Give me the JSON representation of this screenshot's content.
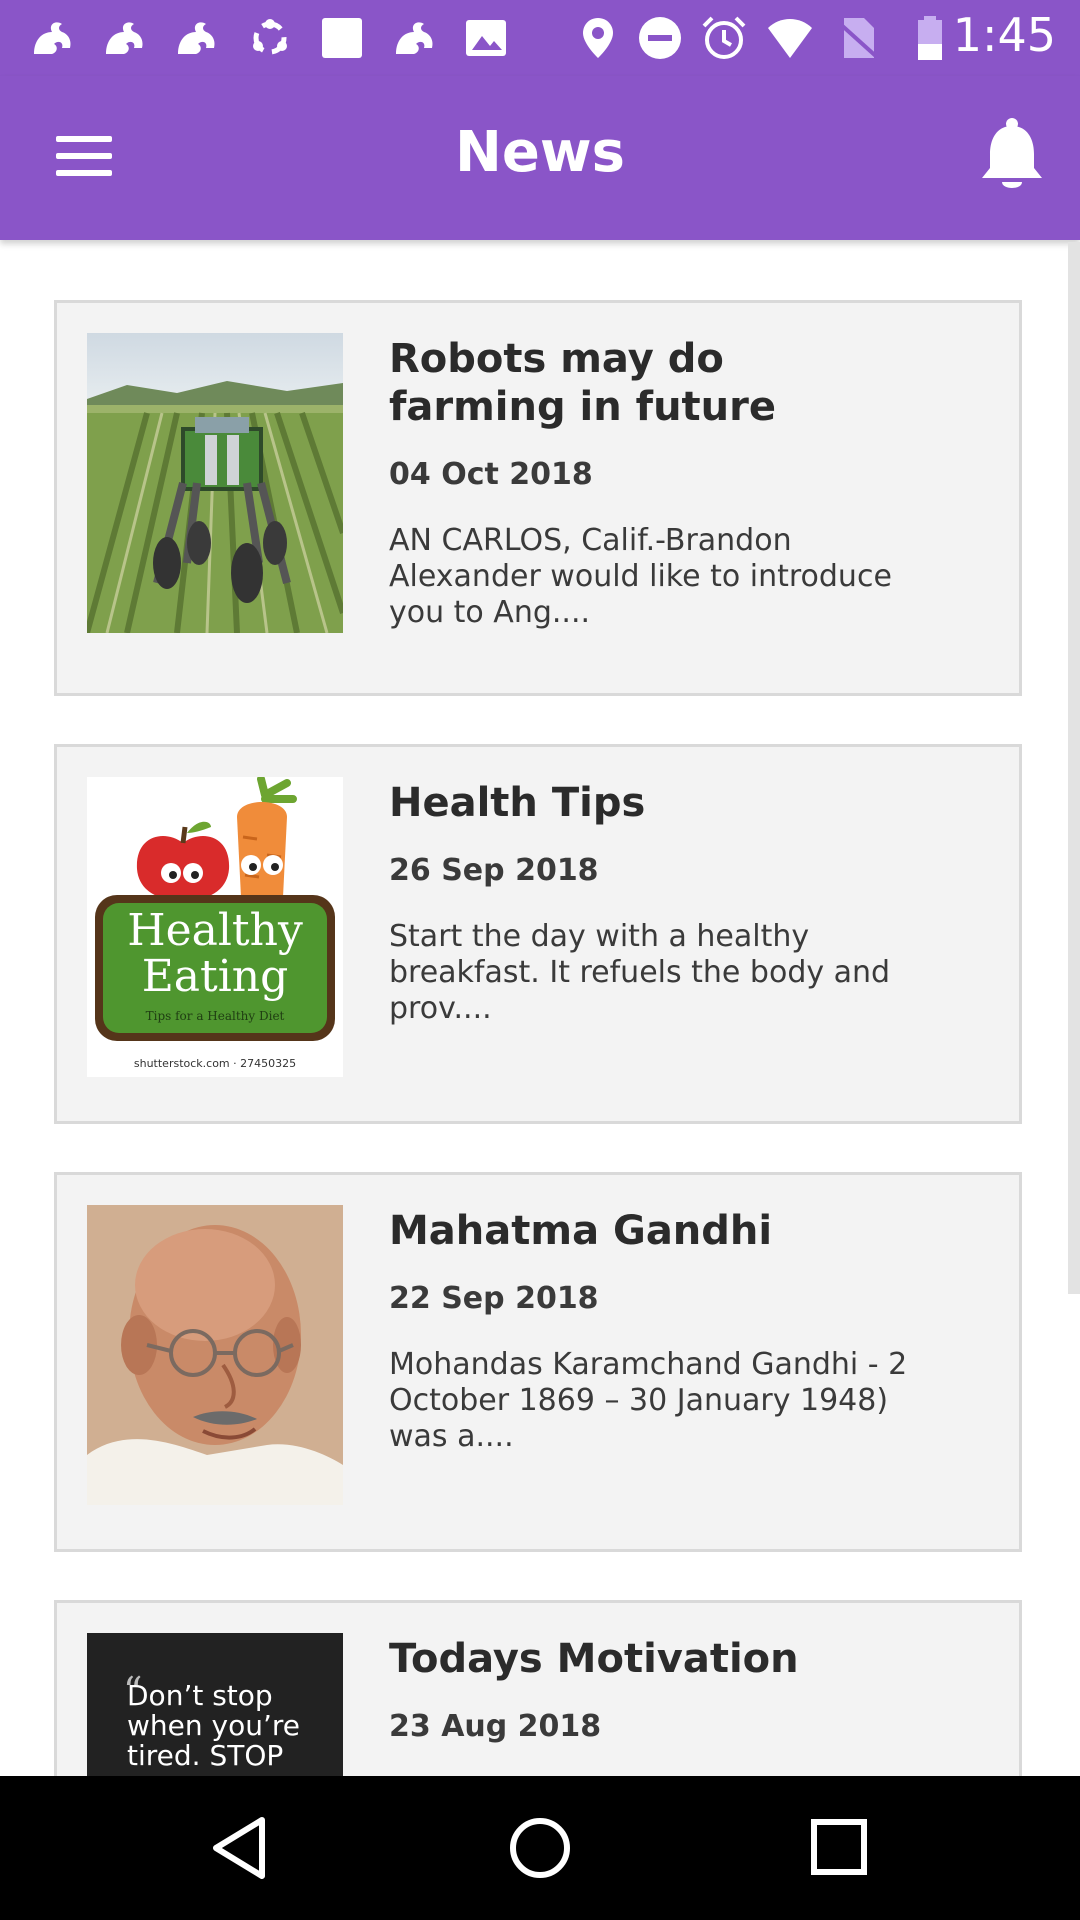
{
  "status_bar": {
    "time": "1:45",
    "icons": [
      "uc-browser-icon",
      "uc-browser-icon",
      "uc-browser-icon",
      "sync-icon",
      "square-icon",
      "uc-browser-icon",
      "image-icon",
      "location-icon",
      "do-not-disturb-icon",
      "alarm-icon",
      "wifi-icon",
      "no-sim-icon",
      "battery-icon"
    ]
  },
  "app_bar": {
    "title": "News",
    "menu_icon": "hamburger-menu-icon",
    "notification_icon": "bell-icon"
  },
  "articles": [
    {
      "title": "Robots may do farming in future",
      "date": "04 Oct 2018",
      "excerpt": "AN CARLOS, Calif.-Brandon Alexander would like to introduce you to Ang....",
      "thumbnail": "farm-robot-photo"
    },
    {
      "title": "Health Tips",
      "date": "26 Sep 2018",
      "excerpt": "Start the day with a healthy breakfast. It refuels the body and prov....",
      "thumbnail": "healthy-eating-illustration",
      "thumb_text": {
        "line1": "Healthy",
        "line2": "Eating",
        "subtitle": "Tips for a Healthy Diet",
        "credit": "shutterstock.com · 27450325"
      }
    },
    {
      "title": "Mahatma Gandhi",
      "date": "22 Sep 2018",
      "excerpt": "Mohandas Karamchand Gandhi - 2 October 1869 – 30 January 1948) was a....",
      "thumbnail": "gandhi-portrait"
    },
    {
      "title": "Todays Motivation",
      "date": "23 Aug 2018",
      "excerpt": "",
      "thumbnail": "motivational-quote-image",
      "thumb_text": {
        "quote": "Don’t stop when you’re tired. STOP"
      }
    }
  ],
  "nav_bar": {
    "back": "back-icon",
    "home": "home-icon",
    "recents": "recents-icon"
  },
  "colors": {
    "primary": "#8a55c8",
    "card_bg": "#f3f3f3",
    "card_border": "#d9d9d9"
  }
}
